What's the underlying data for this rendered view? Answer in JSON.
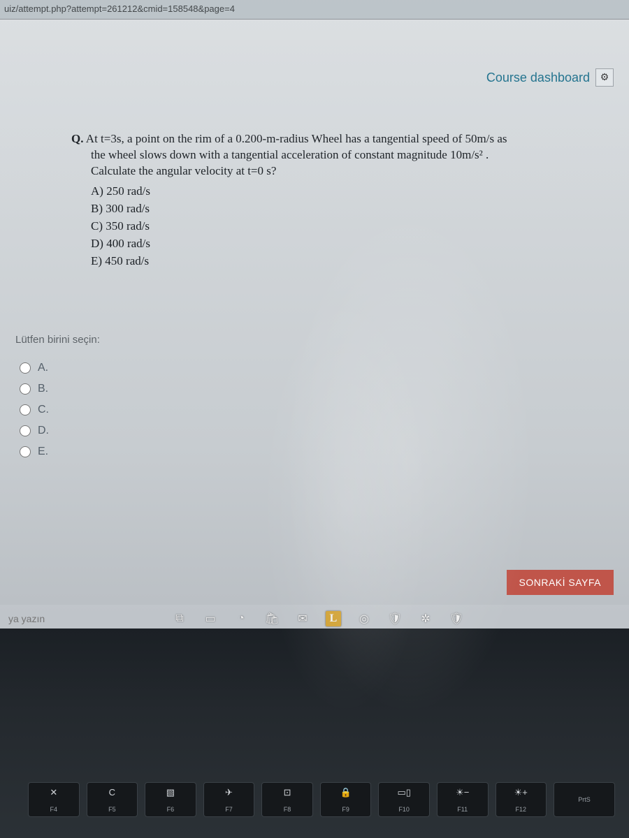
{
  "address_bar": "uiz/attempt.php?attempt=261212&cmid=158548&page=4",
  "header": {
    "dashboard_label": "Course dashboard"
  },
  "question": {
    "prefix": "Q.",
    "text_line1": "At t=3s, a point on the rim of a 0.200-m-radius Wheel has a tangential speed of 50m/s  as",
    "text_line2": "the wheel slows down with a tangential acceleration of constant magnitude 10m/s² .",
    "text_line3": "Calculate the angular velocity at t=0 s?",
    "options_inline": {
      "a": "A) 250 rad/s",
      "b": "B) 300 rad/s",
      "c": "C) 350 rad/s",
      "d": "D) 400 rad/s",
      "e": "E) 450 rad/s"
    }
  },
  "select_prompt": "Lütfen birini seçin:",
  "radio_options": {
    "a": "A.",
    "b": "B.",
    "c": "C.",
    "d": "D.",
    "e": "E."
  },
  "next_button": "SONRAKİ SAYFA",
  "search_placeholder": "ya yazın",
  "fn_keys": {
    "f4": "F4",
    "f5": "F5",
    "f6": "F6",
    "f7": "F7",
    "f8": "F8",
    "f9": "F9",
    "f10": "F10",
    "f11": "F11",
    "f12": "F12",
    "prts": "PrtS"
  },
  "fn_icons": {
    "f4": "✕",
    "f5": "C",
    "f6": "▧",
    "f7": "✈",
    "f8": "⊡",
    "f9": "🔒",
    "f10": "▭▯",
    "f11": "☀−",
    "f12": "☀+"
  }
}
